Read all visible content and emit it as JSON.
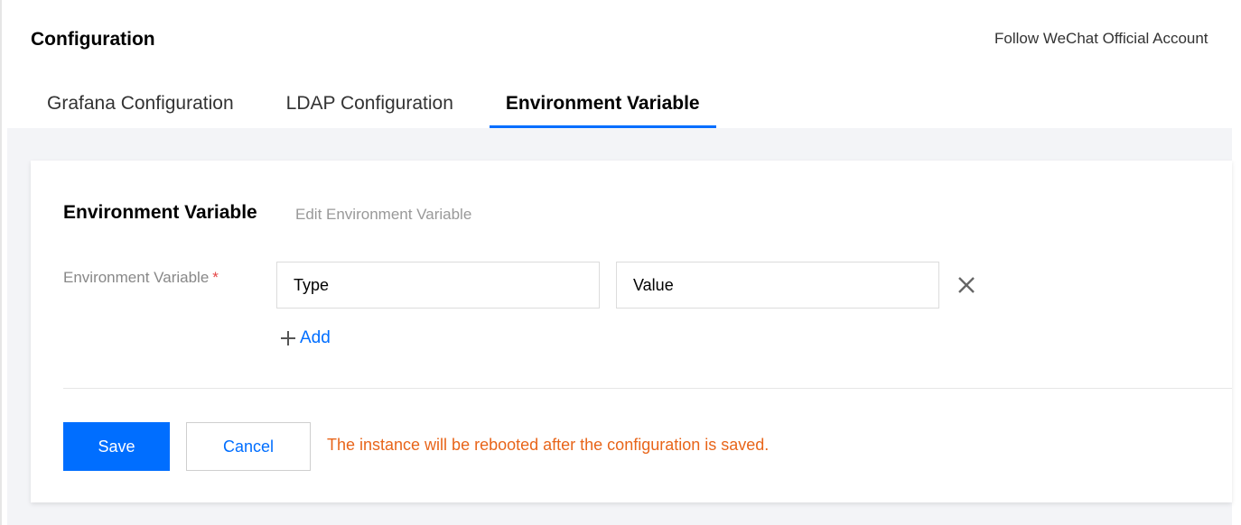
{
  "header": {
    "title": "Configuration",
    "follow_link": "Follow WeChat Official Account"
  },
  "tabs": [
    {
      "label": "Grafana Configuration",
      "active": false
    },
    {
      "label": "LDAP Configuration",
      "active": false
    },
    {
      "label": "Environment Variable",
      "active": true
    }
  ],
  "card": {
    "title": "Environment Variable",
    "subtitle": "Edit Environment Variable",
    "field_label": "Environment Variable",
    "required_mark": "*",
    "type_placeholder": "Type",
    "value_placeholder": "Value",
    "add_label": "Add",
    "remove_icon": "close-icon",
    "add_icon": "plus-icon"
  },
  "footer": {
    "save_label": "Save",
    "cancel_label": "Cancel",
    "warning": "The instance will be rebooted after the configuration is saved."
  },
  "colors": {
    "accent": "#006eff",
    "warning": "#e8651a",
    "required": "#e54545",
    "page_background": "#f3f4f7"
  }
}
